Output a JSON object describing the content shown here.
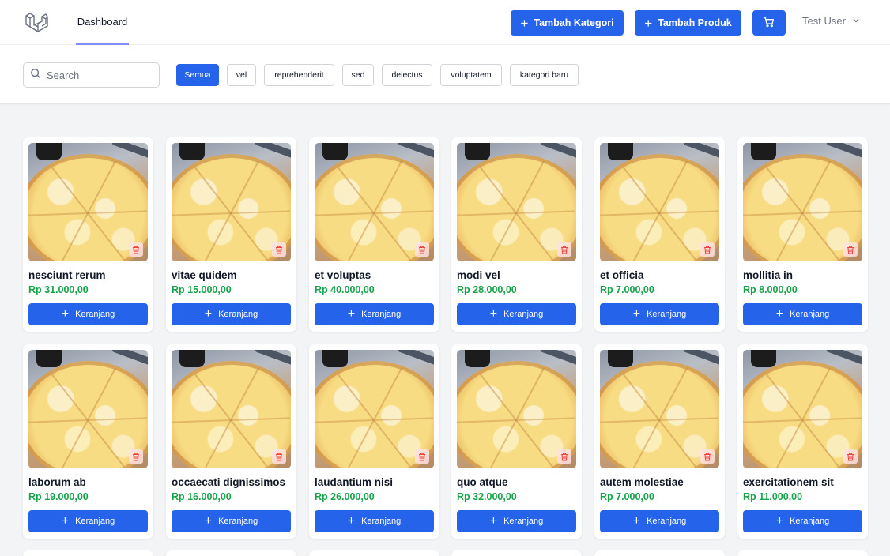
{
  "nav": {
    "active_link": "Dashboard"
  },
  "toolbar": {
    "add_category_label": "Tambah Kategori",
    "add_product_label": "Tambah Produk"
  },
  "user": {
    "name": "Test User"
  },
  "search": {
    "placeholder": "Search",
    "value": ""
  },
  "categories": [
    "Semua",
    "vel",
    "reprehenderit",
    "sed",
    "delectus",
    "voluptatem",
    "kategori baru"
  ],
  "active_category": "Semua",
  "cart_button_label": "Keranjang",
  "products": [
    {
      "name": "nesciunt rerum",
      "price": "Rp 31.000,00"
    },
    {
      "name": "vitae quidem",
      "price": "Rp 15.000,00"
    },
    {
      "name": "et voluptas",
      "price": "Rp 40.000,00"
    },
    {
      "name": "modi vel",
      "price": "Rp 28.000,00"
    },
    {
      "name": "et officia",
      "price": "Rp 7.000,00"
    },
    {
      "name": "mollitia in",
      "price": "Rp 8.000,00"
    },
    {
      "name": "laborum ab",
      "price": "Rp 19.000,00"
    },
    {
      "name": "occaecati dignissimos",
      "price": "Rp 16.000,00"
    },
    {
      "name": "laudantium nisi",
      "price": "Rp 26.000,00"
    },
    {
      "name": "quo atque",
      "price": "Rp 32.000,00"
    },
    {
      "name": "autem molestiae",
      "price": "Rp 7.000,00"
    },
    {
      "name": "exercitationem sit",
      "price": "Rp 11.000,00"
    }
  ],
  "colors": {
    "primary": "#2563eb",
    "price": "#16a34a",
    "background": "#f3f4f6"
  },
  "icons": {
    "logo": "laravel-logo-icon",
    "cart": "cart-icon",
    "delete": "trash-icon",
    "user_menu": "chevron-down-icon",
    "search": "search-icon",
    "add": "plus-icon"
  }
}
